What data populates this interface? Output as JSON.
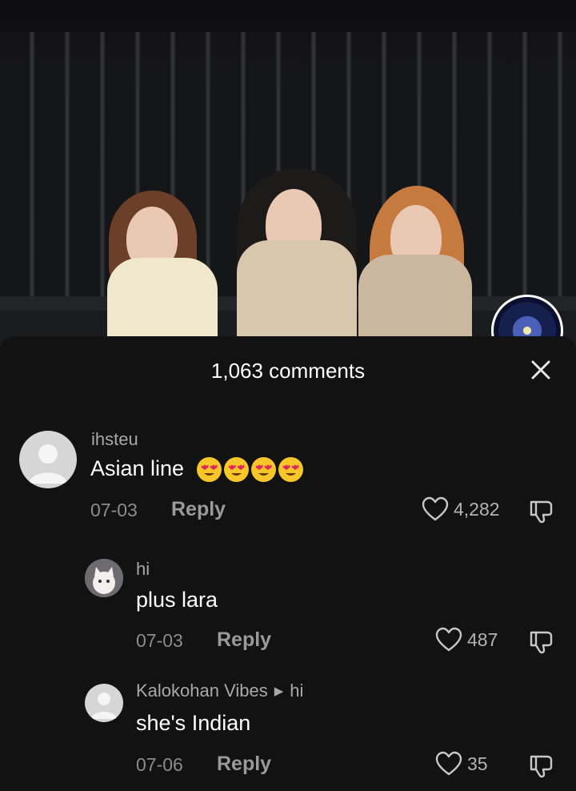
{
  "header": {
    "comments_title": "1,063 comments"
  },
  "icons": {
    "close": "close-icon",
    "heart": "heart-icon",
    "dislike": "thumbs-down-icon",
    "emoji": "heart-eyes-emoji"
  },
  "colors": {
    "sheet_background": "#121212",
    "text_primary": "#ffffff",
    "text_secondary": "#a8a8a8"
  },
  "comments": [
    {
      "username": "ihsteu",
      "text": "Asian line",
      "emoji_count": 4,
      "date": "07-03",
      "reply_label": "Reply",
      "likes": "4,282"
    },
    {
      "username": "hi",
      "text": "plus lara",
      "date": "07-03",
      "reply_label": "Reply",
      "likes": "487"
    },
    {
      "username": "Kalokohan Vibes",
      "reply_to": "hi",
      "text": "she's Indian",
      "date": "07-06",
      "reply_label": "Reply",
      "likes": "35"
    }
  ]
}
